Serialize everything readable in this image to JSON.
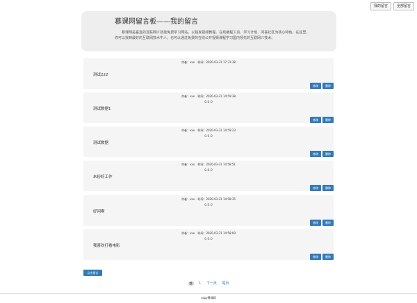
{
  "header": {
    "my_messages": "我的留言",
    "all_messages": "全部留言"
  },
  "jumbotron": {
    "title": "慕课网留言板——我的留言",
    "text": "慕课网是垂直的互联网IT技能免费学习网站。以独家视频教程、在线编程工具、学习计划、问答社区为核心特色。在这里，你可以找到最好的互联网技术牛人，也可以通过免费的在线公开视频课程学习国内领先的互联网IT技术。"
  },
  "author_label": "作者：",
  "time_label": "时间：",
  "edit_label": "修改",
  "delete_label": "删除",
  "messages": [
    {
      "author": "xxx",
      "time": "2020-03-31 17:31:38",
      "subtitle": "",
      "content": "测试222"
    },
    {
      "author": "xxx",
      "time": "2020-03-31 14:59:38",
      "subtitle": "0.0.0",
      "content": "测试数据1"
    },
    {
      "author": "xxx",
      "time": "2020-03-31 14:59:23",
      "subtitle": "0.0.0",
      "content": "测试数据"
    },
    {
      "author": "xxx",
      "time": "2020-03-31 14:58:51",
      "subtitle": "0.0.0",
      "content": "未份好工作"
    },
    {
      "author": "xxx",
      "time": "2020-03-31 14:58:35",
      "subtitle": "0.0.0",
      "content": "好闲啊"
    },
    {
      "author": "xxx",
      "time": "2020-03-31 14:58:09",
      "subtitle": "0.0.0",
      "content": "我喜欢打看电影"
    }
  ],
  "add_button": "点击留言",
  "pagination": {
    "first": "首",
    "current": "1",
    "next": "下一页",
    "last": "尾页"
  },
  "footer": "copy慕课网"
}
